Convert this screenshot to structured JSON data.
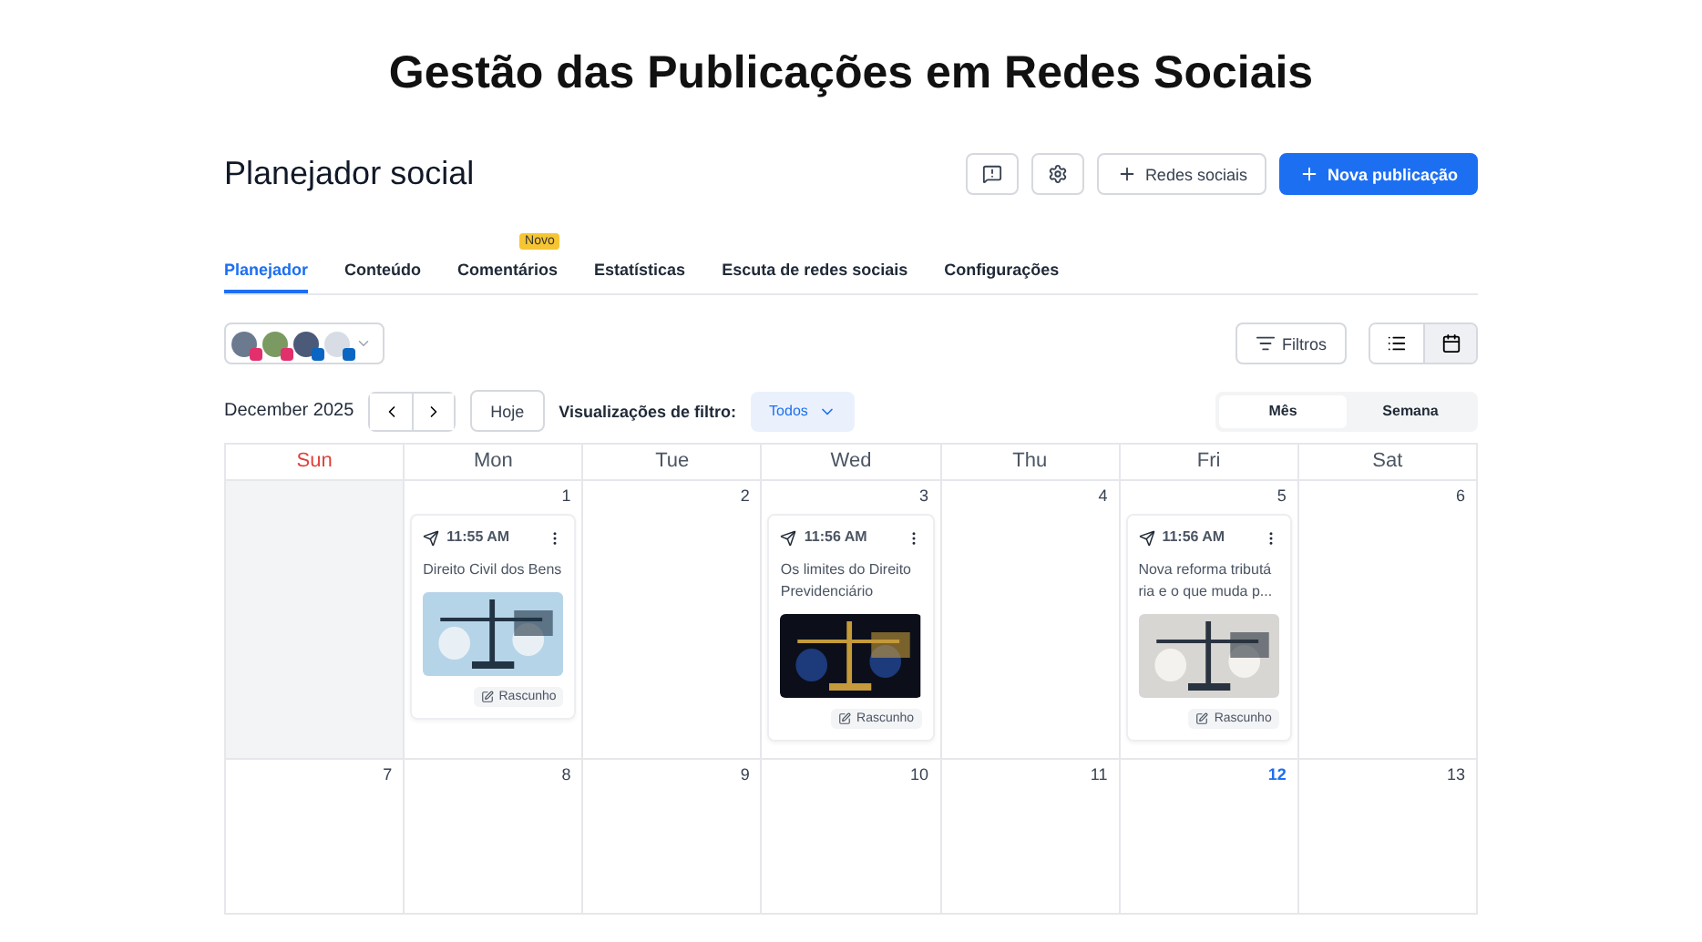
{
  "banner": {
    "title": "Gestão das Publicações em Redes Sociais"
  },
  "header": {
    "title": "Planejador social",
    "buttons": [
      {
        "kind": "feedback"
      },
      {
        "kind": "settings"
      },
      {
        "kind": "outline",
        "label": "Redes sociais"
      },
      {
        "kind": "primary",
        "label": "Nova publicação"
      }
    ]
  },
  "tabs": [
    {
      "label": "Planejador",
      "selected": true
    },
    {
      "label": "Conteúdo",
      "selected": false
    },
    {
      "label": "Comentários",
      "selected": false,
      "badge": "Novo"
    },
    {
      "label": "Estatísticas",
      "selected": false
    },
    {
      "label": "Escuta de redes sociais",
      "selected": false
    },
    {
      "label": "Configurações",
      "selected": false
    }
  ],
  "accounts": [
    {
      "kind": "instagram",
      "color": "#6b7a8f"
    },
    {
      "kind": "instagram",
      "color": "#7a9a62"
    },
    {
      "kind": "linkedin",
      "color": "#4a5a78"
    },
    {
      "kind": "linkedin",
      "color": "#d8dde5"
    }
  ],
  "toolbar": {
    "filters": "Filtros",
    "views": [
      {
        "kind": "list",
        "selected": false
      },
      {
        "kind": "calendar",
        "selected": true
      }
    ]
  },
  "nav": {
    "month": "December 2025",
    "today": "Hoje",
    "filter_label": "Visualizações de filtro:",
    "filter_value": "Todos",
    "modes": [
      {
        "label": "Mês",
        "selected": true
      },
      {
        "label": "Semana",
        "selected": false
      }
    ]
  },
  "weekdays": [
    {
      "label": "Sun",
      "weekend": true
    },
    {
      "label": "Mon",
      "weekend": false
    },
    {
      "label": "Tue",
      "weekend": false
    },
    {
      "label": "Wed",
      "weekend": false
    },
    {
      "label": "Thu",
      "weekend": false
    },
    {
      "label": "Fri",
      "weekend": false
    },
    {
      "label": "Sat",
      "weekend": false
    }
  ],
  "weeks": [
    [
      {
        "muted": true
      },
      {
        "day": "1",
        "today": false,
        "post": {
          "time": "11:55 AM",
          "text": "Direito Civil dos Bens",
          "status": "Rascunho"
        }
      },
      {
        "day": "2",
        "today": false
      },
      {
        "day": "3",
        "today": false,
        "post": {
          "time": "11:56 AM",
          "text": "Os limites do Direito Previdenciário",
          "status": "Rascunho"
        }
      },
      {
        "day": "4",
        "today": false
      },
      {
        "day": "5",
        "today": false,
        "post": {
          "time": "11:56 AM",
          "text": "Nova reforma tributá ria e o que muda p...",
          "status": "Rascunho"
        }
      },
      {
        "day": "6",
        "today": false
      }
    ],
    [
      {
        "day": "7",
        "today": false
      },
      {
        "day": "8",
        "today": false
      },
      {
        "day": "9",
        "today": false
      },
      {
        "day": "10",
        "today": false
      },
      {
        "day": "11",
        "today": false
      },
      {
        "day": "12",
        "today": true
      },
      {
        "day": "13",
        "today": false
      }
    ]
  ]
}
